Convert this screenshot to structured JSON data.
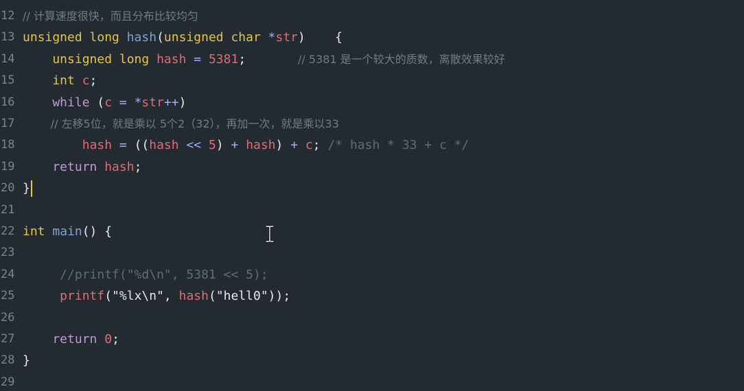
{
  "editor": {
    "lines": [
      {
        "num": "12",
        "segments": [
          {
            "t": "// 计算速度很快，而且分布比较均匀",
            "c": "cmt-zh"
          }
        ]
      },
      {
        "num": "13",
        "segments": [
          {
            "t": "unsigned long ",
            "c": "kw"
          },
          {
            "t": "hash",
            "c": "fn"
          },
          {
            "t": "(",
            "c": "punct"
          },
          {
            "t": "unsigned char ",
            "c": "kw"
          },
          {
            "t": "*",
            "c": "op"
          },
          {
            "t": "str",
            "c": "var"
          },
          {
            "t": ")    {",
            "c": "punct"
          }
        ]
      },
      {
        "num": "14",
        "segments": [
          {
            "t": "    unsigned long ",
            "c": "kw"
          },
          {
            "t": "hash",
            "c": "var"
          },
          {
            "t": " = ",
            "c": "op"
          },
          {
            "t": "5381",
            "c": "num"
          },
          {
            "t": ";       ",
            "c": "punct"
          },
          {
            "t": "// 5381 是一个较大的质数，离散效果较好",
            "c": "cmt-zh"
          }
        ]
      },
      {
        "num": "15",
        "segments": [
          {
            "t": "    int ",
            "c": "kw"
          },
          {
            "t": "c",
            "c": "var"
          },
          {
            "t": ";",
            "c": "punct"
          }
        ]
      },
      {
        "num": "16",
        "segments": [
          {
            "t": "    while ",
            "c": "ctl"
          },
          {
            "t": "(",
            "c": "punct"
          },
          {
            "t": "c",
            "c": "var"
          },
          {
            "t": " = ",
            "c": "op"
          },
          {
            "t": "*",
            "c": "op"
          },
          {
            "t": "str",
            "c": "var"
          },
          {
            "t": "++",
            "c": "op"
          },
          {
            "t": ")",
            "c": "punct"
          }
        ]
      },
      {
        "num": "17",
        "segments": [
          {
            "t": "        // 左移5位，就是乘以 5个2（32），再加一次，就是乘以33",
            "c": "cmt-zh"
          }
        ]
      },
      {
        "num": "18",
        "segments": [
          {
            "t": "        hash",
            "c": "var"
          },
          {
            "t": " = ",
            "c": "op"
          },
          {
            "t": "((",
            "c": "punct"
          },
          {
            "t": "hash",
            "c": "var"
          },
          {
            "t": " << ",
            "c": "op"
          },
          {
            "t": "5",
            "c": "num"
          },
          {
            "t": ") ",
            "c": "punct"
          },
          {
            "t": "+ ",
            "c": "op"
          },
          {
            "t": "hash",
            "c": "var"
          },
          {
            "t": ") ",
            "c": "punct"
          },
          {
            "t": "+ ",
            "c": "op"
          },
          {
            "t": "c",
            "c": "var"
          },
          {
            "t": "; ",
            "c": "punct"
          },
          {
            "t": "/* hash * 33 + c */",
            "c": "cmt"
          }
        ]
      },
      {
        "num": "19",
        "segments": [
          {
            "t": "    return ",
            "c": "ctl"
          },
          {
            "t": "hash",
            "c": "var"
          },
          {
            "t": ";",
            "c": "punct"
          }
        ]
      },
      {
        "num": "20",
        "segments": [
          {
            "t": "}",
            "c": "punct"
          }
        ],
        "caret": true
      },
      {
        "num": "21",
        "segments": []
      },
      {
        "num": "22",
        "segments": [
          {
            "t": "int ",
            "c": "kw"
          },
          {
            "t": "main",
            "c": "fn"
          },
          {
            "t": "() {",
            "c": "punct"
          }
        ]
      },
      {
        "num": "23",
        "segments": []
      },
      {
        "num": "24",
        "segments": [
          {
            "t": "     //printf(\"%d\\n\", 5381 << 5);",
            "c": "cmt"
          }
        ]
      },
      {
        "num": "25",
        "segments": [
          {
            "t": "     printf",
            "c": "var"
          },
          {
            "t": "(",
            "c": "punct"
          },
          {
            "t": "\"%lx\\n\"",
            "c": "str"
          },
          {
            "t": ", ",
            "c": "punct"
          },
          {
            "t": "hash",
            "c": "var"
          },
          {
            "t": "(",
            "c": "punct"
          },
          {
            "t": "\"hell0\"",
            "c": "str"
          },
          {
            "t": "));",
            "c": "punct"
          }
        ]
      },
      {
        "num": "26",
        "segments": []
      },
      {
        "num": "27",
        "segments": [
          {
            "t": "    return ",
            "c": "ctl"
          },
          {
            "t": "0",
            "c": "num"
          },
          {
            "t": ";",
            "c": "punct"
          }
        ]
      },
      {
        "num": "28",
        "segments": [
          {
            "t": "}",
            "c": "punct"
          }
        ]
      },
      {
        "num": "29",
        "segments": []
      }
    ],
    "cursor_icon": "text-cursor-icon",
    "colors": {
      "background": "#232a31",
      "keyword": "#e7c547",
      "control": "#c397d8",
      "function": "#7aa6da",
      "identifier": "#e06c75",
      "comment": "#626c75",
      "line_number": "#7c858c"
    }
  }
}
